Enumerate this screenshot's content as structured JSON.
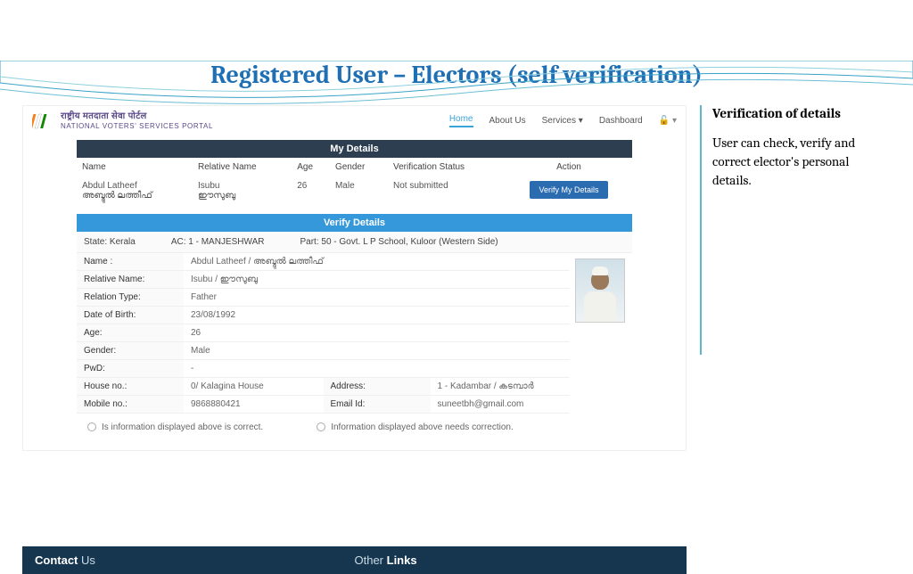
{
  "slide": {
    "title": "Registered User – Electors (self verification)"
  },
  "sidebar": {
    "heading": "Verification of details",
    "body": " User can check, verify and correct elector's personal details."
  },
  "portal": {
    "logo_hi": "राष्ट्रीय मतदाता सेवा पोर्टल",
    "logo_en": "NATIONAL VOTERS' SERVICES PORTAL",
    "nav": [
      "Home",
      "About Us",
      "Services",
      "Dashboard"
    ],
    "nav_active": "Home"
  },
  "my_details": {
    "title": "My Details",
    "headers": [
      "Name",
      "Relative Name",
      "Age",
      "Gender",
      "Verification Status",
      "Action"
    ],
    "row": {
      "name": "Abdul Latheef",
      "name_native": "അബ്ദുൽ ലത്തീഫ്",
      "relative": "Isubu",
      "relative_native": "ഈസുബു",
      "age": "26",
      "gender": "Male",
      "status": "Not submitted",
      "action_label": "Verify My Details"
    }
  },
  "verify": {
    "title": "Verify Details",
    "state_label": "State:",
    "state": "Kerala",
    "ac_label": "AC:",
    "ac": "1 - MANJESHWAR",
    "part_label": "Part:",
    "part": "50 - Govt. L P School, Kuloor (Western Side)",
    "fields": {
      "name_label": "Name :",
      "name": "Abdul Latheef  /  അബ്ദുൽ ലത്തീഫ്",
      "relative_label": "Relative Name:",
      "relative": "Isubu  /  ഈസുബു",
      "reltype_label": "Relation Type:",
      "reltype": "Father",
      "dob_label": "Date of Birth:",
      "dob": "23/08/1992",
      "age_label": "Age:",
      "age": "26",
      "gender_label": "Gender:",
      "gender": "Male",
      "pwd_label": "PwD:",
      "pwd": "-",
      "house_label": "House no.:",
      "house": "0/ Kalagina House",
      "address_label": "Address:",
      "address": "1 - Kadambar / കടമ്പാർ",
      "mobile_label": "Mobile no.:",
      "mobile": "9868880421",
      "email_label": "Email Id:",
      "email": "suneetbh@gmail.com"
    },
    "radio1": "Is information displayed above is correct.",
    "radio2": "Information displayed above needs correction."
  },
  "footer": {
    "contact_b": "Contact",
    "contact_t": " Us",
    "other_t": "Other ",
    "other_b": "Links"
  }
}
